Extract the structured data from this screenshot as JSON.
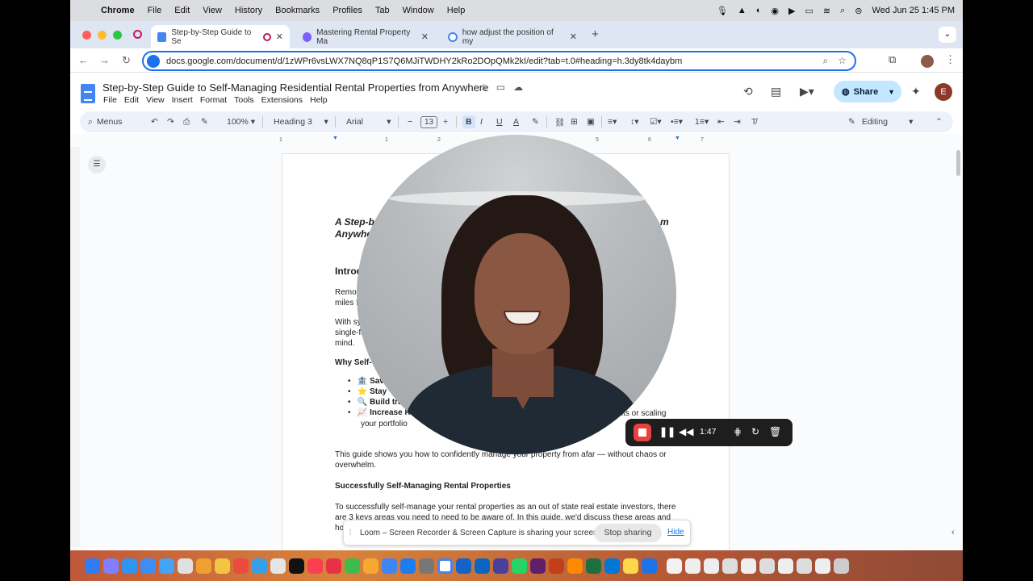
{
  "menubar": {
    "app": "Chrome",
    "items": [
      "File",
      "Edit",
      "View",
      "History",
      "Bookmarks",
      "Profiles",
      "Tab",
      "Window",
      "Help"
    ],
    "clock": "Wed Jun 25  1:45 PM"
  },
  "tabs": [
    {
      "title": "Step-by-Step Guide to Se",
      "active": true
    },
    {
      "title": "Mastering Rental Property Ma",
      "active": false
    },
    {
      "title": "how adjust the position of my",
      "active": false
    }
  ],
  "address": {
    "url": "docs.google.com/document/d/1zWPr6vsLWX7NQ8qP1S7Q6MJiTWDHY2kRo2DOpQMk2kI/edit?tab=t.0#heading=h.3dy8tk4daybm"
  },
  "doc": {
    "title": "Step-by-Step Guide to Self-Managing Residential Rental Properties from Anywhere",
    "menu": [
      "File",
      "Edit",
      "View",
      "Insert",
      "Format",
      "Tools",
      "Extensions",
      "Help"
    ],
    "share_label": "Share",
    "avatar_letter": "E"
  },
  "format_toolbar": {
    "menus_label": "Menus",
    "zoom": "100%",
    "style": "Heading 3",
    "font": "Arial",
    "font_size": "13",
    "mode": "Editing"
  },
  "ruler": {
    "ticks": [
      "1",
      "1",
      "2",
      "3",
      "4",
      "5",
      "6",
      "7"
    ]
  },
  "page": {
    "heading_a": "A Step-b",
    "heading_a_end": "m",
    "heading_b": "Anywhe",
    "intro": "Introd",
    "p1a": "Remot",
    "p1b": "miles f",
    "p2a": "With sy",
    "p2b": "single-fa",
    "p2c": "mind.",
    "why": "Why Self-",
    "bullets": [
      "Sav",
      "Stay",
      "Build tra",
      "Increase R"
    ],
    "bullet_tail": "ents or scaling",
    "bullet_tail2": "your portfolio",
    "p3a": "This guide shows you how to confidently manage your property from afar — without chaos or",
    "p3b": "overwhelm.",
    "h_success": "Successfully Self-Managing Rental Properties",
    "p4a": "To successfully self-manage your rental properties as an out of state real estate investors, there",
    "p4b": "are 3 keys areas you need to need to be aware of. In this guide, we'd discuss these areas and",
    "p4c": "ho"
  },
  "loom": {
    "timer": "1:47",
    "banner_text": "Loom – Screen Recorder & Screen Capture is sharing your screen.",
    "stop_label": "Stop sharing",
    "hide_label": "Hide"
  },
  "colors": {
    "accent": "#1a73e8",
    "share_bg": "#c2e7ff",
    "record_red": "#e8423f"
  }
}
